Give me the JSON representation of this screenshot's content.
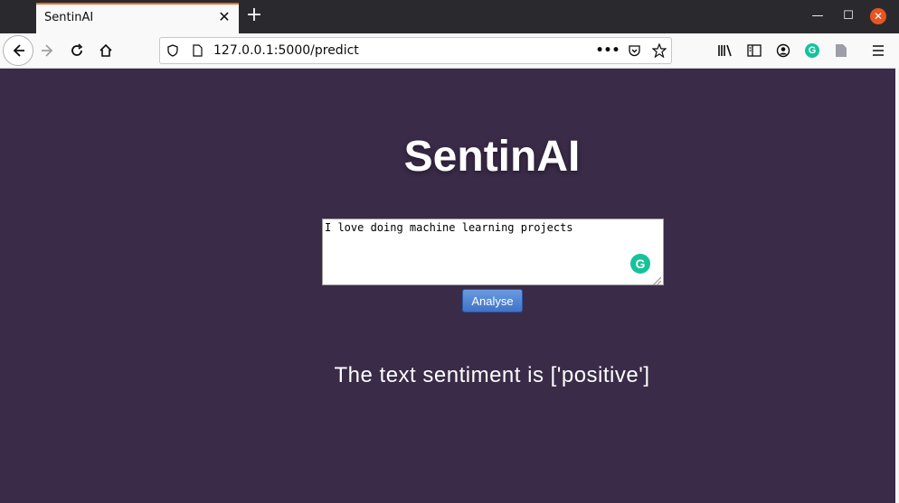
{
  "browser": {
    "tab_title": "SentinAI",
    "url": "127.0.0.1:5000/predict"
  },
  "page": {
    "title": "SentinAI",
    "input_value": "I love doing machine learning projects",
    "analyse_label": "Analyse",
    "result_text": "The text sentiment is ['positive']"
  },
  "colors": {
    "page_background": "#3a2b48",
    "button_blue": "#3f73c9",
    "grammarly_green": "#15c39a",
    "tab_accent": "#e66a2c"
  }
}
